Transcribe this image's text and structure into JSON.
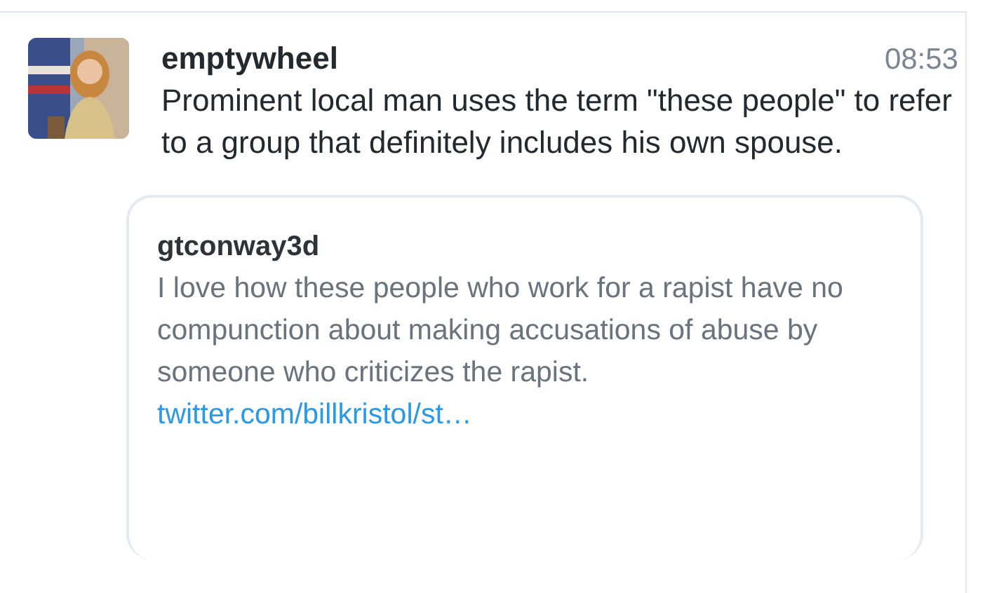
{
  "tweet": {
    "author": "emptywheel",
    "time": "08:53",
    "text": "Prominent local man uses the term \"these people\" to refer to a group that definitely includes his own spouse.",
    "quote": {
      "author": "gtconway3d",
      "text": "I love how these people who work for a rapist have no compunction about making accusations of abuse by someone who criticizes the rapist.",
      "link": "twitter.com/billkristol/st…"
    }
  }
}
